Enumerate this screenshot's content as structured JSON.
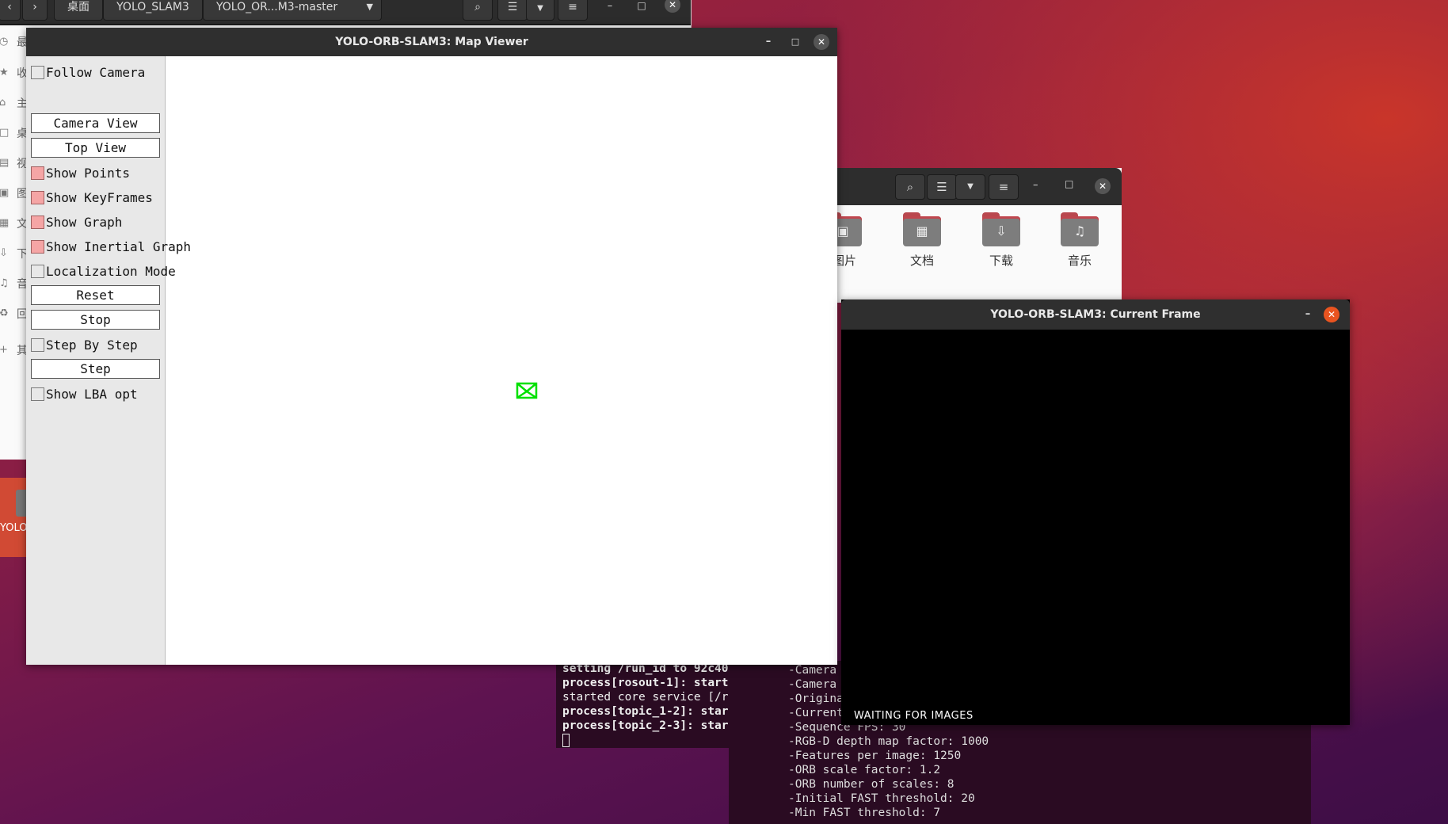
{
  "bg_file_manager": {
    "back_icon": "chevron-left-icon",
    "forward_icon": "chevron-right-icon",
    "path_segments": [
      "桌面",
      "YOLO_SLAM3",
      "YOLO_OR...M3-master"
    ],
    "sidebar_chars": [
      "最",
      "收",
      "主",
      "桌",
      "视",
      "图",
      "文",
      "下",
      "音",
      "回",
      "其"
    ],
    "launcher_label": "YOLO"
  },
  "right_file_manager": {
    "folders": [
      {
        "label": "图片",
        "icon": "picture-icon"
      },
      {
        "label": "文档",
        "icon": "document-icon"
      },
      {
        "label": "下载",
        "icon": "download-icon"
      },
      {
        "label": "音乐",
        "icon": "music-icon"
      }
    ]
  },
  "map_viewer": {
    "title": "YOLO-ORB-SLAM3: Map Viewer",
    "controls": {
      "follow_camera": "Follow Camera",
      "camera_view": "Camera View",
      "top_view": "Top View",
      "show_points": "Show Points",
      "show_keyframes": "Show KeyFrames",
      "show_graph": "Show Graph",
      "show_inertial_graph": "Show Inertial Graph",
      "localization_mode": "Localization Mode",
      "reset": "Reset",
      "stop": "Stop",
      "step_by_step": "Step By Step",
      "step": "Step",
      "show_lba_opt": "Show LBA opt"
    },
    "checked": {
      "follow_camera": false,
      "show_points": true,
      "show_keyframes": true,
      "show_graph": true,
      "show_inertial_graph": true,
      "localization_mode": false,
      "step_by_step": false,
      "show_lba_opt": false
    },
    "camera_color": "#00e000"
  },
  "current_frame": {
    "title": "YOLO-ORB-SLAM3: Current Frame",
    "status": "WAITING FOR IMAGES"
  },
  "terminal_left": {
    "lines": [
      "setting /run_id to 92c40",
      "process[rosout-1]: start",
      "started core service [/r",
      "process[topic_1-2]: star",
      "process[topic_2-3]: star"
    ]
  },
  "terminal_right": {
    "lines": [
      "-Camera",
      "-Camera",
      "-Origina",
      "-Current",
      "-Sequence FPS: 30",
      "-RGB-D depth map factor: 1000",
      "-Features per image: 1250",
      "-ORB scale factor: 1.2",
      "-ORB number of scales: 8",
      "-Initial FAST threshold: 20",
      "-Min FAST threshold: 7"
    ]
  },
  "colors": {
    "checkbox_on": "#f5a5a5",
    "close_button": "#e95420",
    "titlebar": "#2f2f2f"
  }
}
